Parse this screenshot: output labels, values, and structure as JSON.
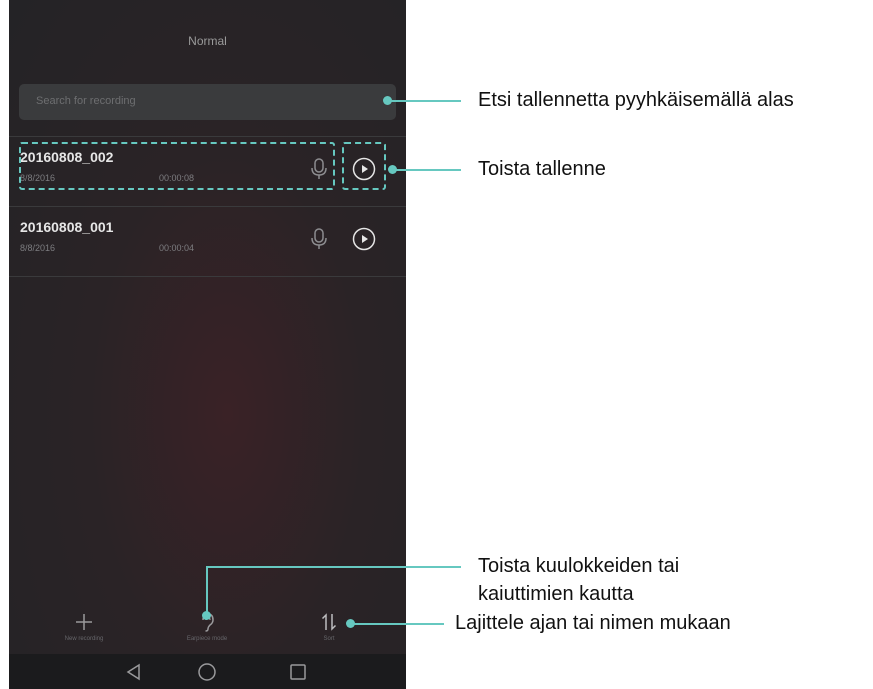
{
  "header": {
    "title": "Normal"
  },
  "search": {
    "placeholder": "Search for recording"
  },
  "recordings": [
    {
      "name": "20160808_002",
      "date": "8/8/2016",
      "duration": "00:00:08"
    },
    {
      "name": "20160808_001",
      "date": "8/8/2016",
      "duration": "00:00:04"
    }
  ],
  "toolbar": {
    "new_recording": "New recording",
    "earpiece_mode": "Earpiece mode",
    "sort": "Sort"
  },
  "callouts": {
    "search": "Etsi tallennetta pyyhkäisemällä alas",
    "play": "Toista tallenne",
    "earpiece_line1": "Toista kuulokkeiden tai",
    "earpiece_line2": "kaiuttimien kautta",
    "sort": "Lajittele ajan tai nimen mukaan"
  },
  "colors": {
    "accent": "#66c8c0",
    "background": "#242326",
    "text": "#e6e6e6"
  }
}
